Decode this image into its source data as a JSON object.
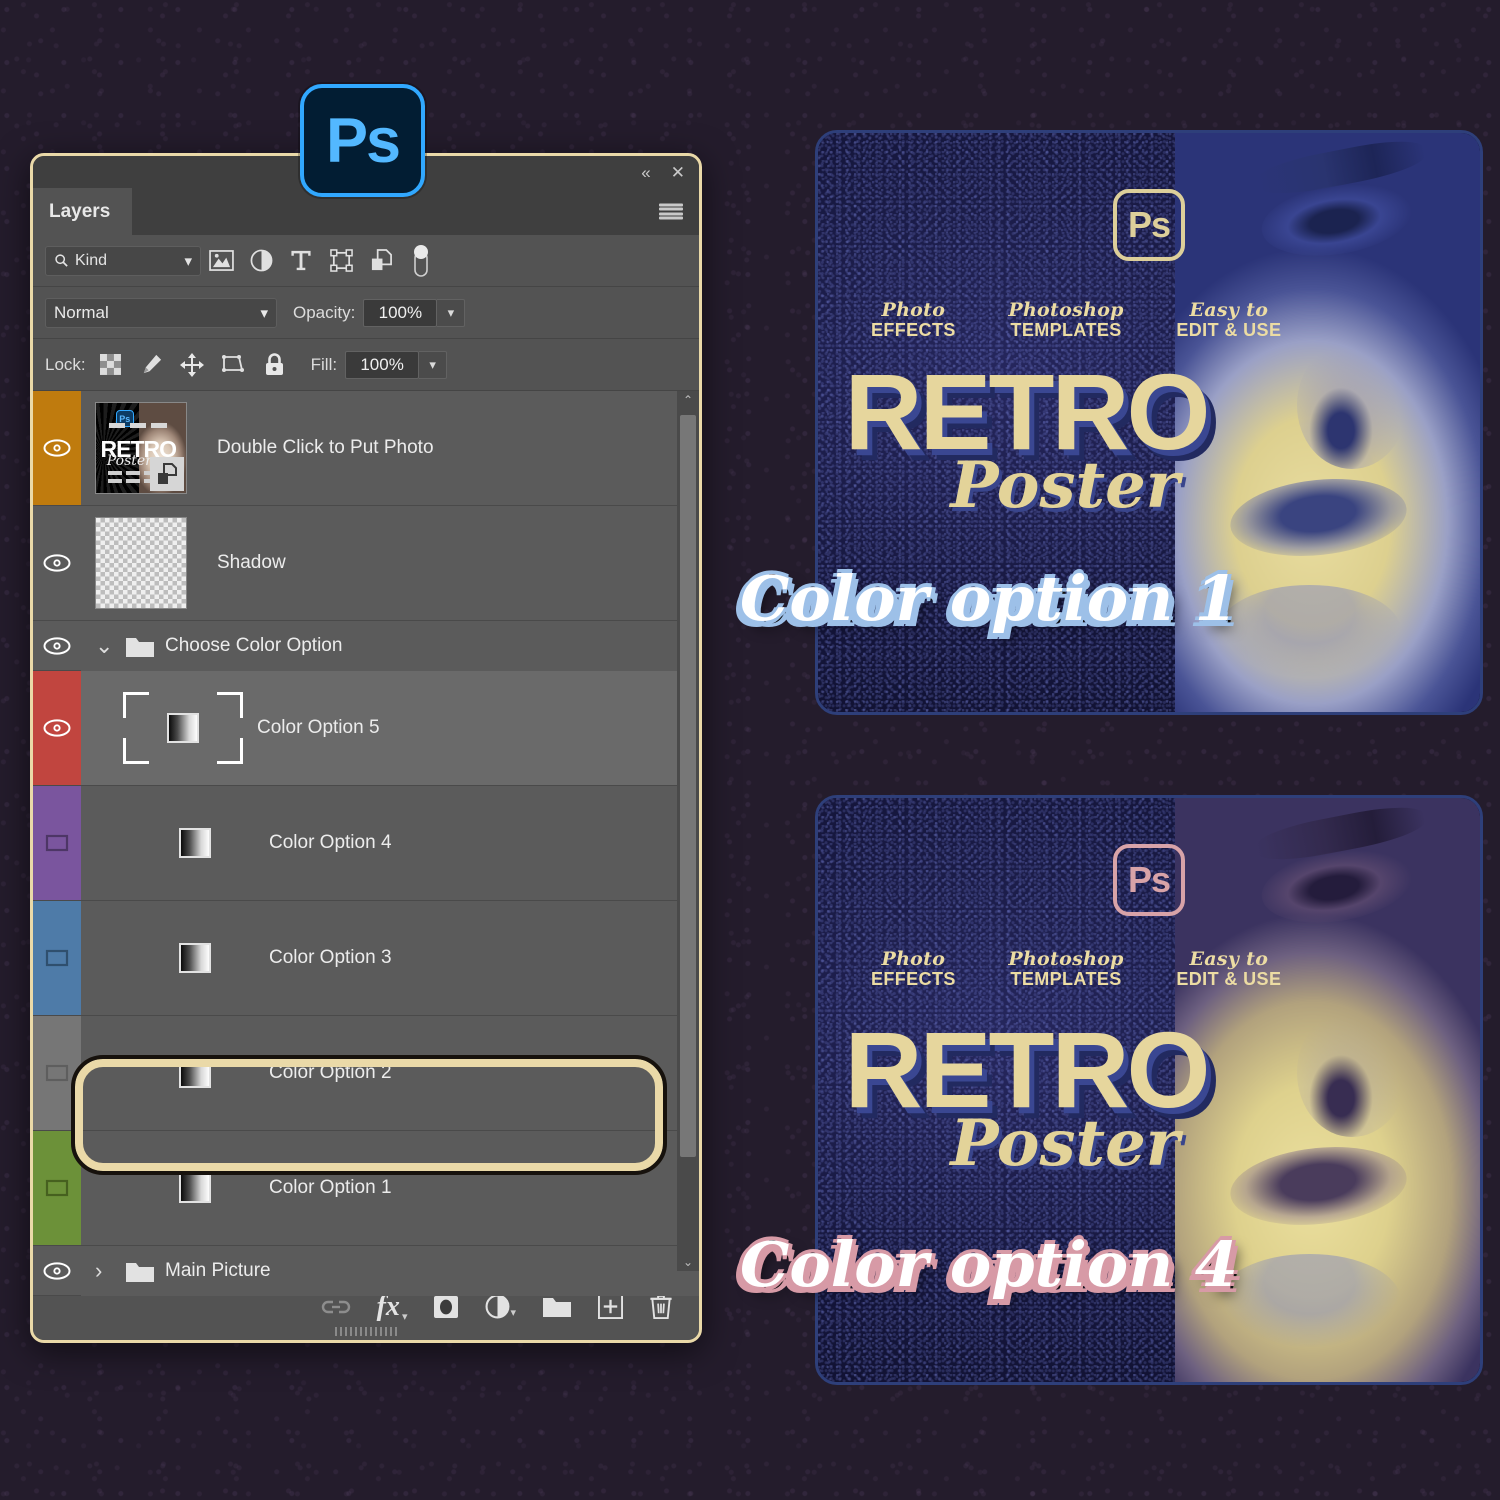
{
  "app": {
    "logo_label": "Ps",
    "background_color": "#241c2c"
  },
  "panel": {
    "tab_label": "Layers",
    "collapse_icon": "«",
    "close_icon": "✕",
    "menu_icon": "hamburger-menu-icon",
    "border_color": "#ead9a8",
    "filter": {
      "kind_label": "Kind",
      "search_icon": "search-icon",
      "chevron": "⌄",
      "icons": [
        "pixel-layer-filter-icon",
        "adjustment-layer-filter-icon",
        "type-layer-filter-icon",
        "shape-layer-filter-icon",
        "smart-object-filter-icon",
        "filter-toggle-switch"
      ]
    },
    "blend": {
      "mode": "Normal",
      "chevron": "⌄",
      "opacity_label": "Opacity:",
      "opacity_value": "100%"
    },
    "lock": {
      "label": "Lock:",
      "fill_label": "Fill:",
      "fill_value": "100%",
      "icons": [
        "lock-transparent-pixels-icon",
        "lock-image-pixels-icon",
        "lock-position-icon",
        "lock-artboard-nesting-icon",
        "lock-all-icon"
      ]
    },
    "layers": [
      {
        "name": "Double Click to Put Photo",
        "visible": true,
        "color_label": "#bf7b0e",
        "kind": "smart-object",
        "thumb": "retro-poster-thumbnail"
      },
      {
        "name": "Shadow",
        "visible": true,
        "color_label": "#5b5b5b",
        "kind": "transparent",
        "thumb": "transparent-checkerboard"
      },
      {
        "name": "Choose Color Option",
        "visible": true,
        "color_label": "#5b5b5b",
        "kind": "group",
        "expanded": true,
        "twirl": "⌄"
      },
      {
        "name": "Color Option 5",
        "visible": true,
        "color_label": "#c1453f",
        "kind": "gradient",
        "selected": true
      },
      {
        "name": "Color Option 4",
        "visible": false,
        "color_label": "#7a559e",
        "kind": "gradient",
        "selected": false
      },
      {
        "name": "Color Option 3",
        "visible": false,
        "color_label": "#4e7ba8",
        "kind": "gradient",
        "selected": false
      },
      {
        "name": "Color Option 2",
        "visible": false,
        "color_label": "#767676",
        "kind": "gradient",
        "selected": false
      },
      {
        "name": "Color Option 1",
        "visible": false,
        "color_label": "#6c9139",
        "kind": "gradient",
        "selected": false
      },
      {
        "name": "Main Picture",
        "visible": true,
        "color_label": "#5b5b5b",
        "kind": "group",
        "expanded": false,
        "twirl": "›"
      }
    ],
    "scrollbar": {
      "up_arrow": "⌃",
      "down_arrow": "⌄"
    },
    "bottom_icons": [
      "link-layers-icon",
      "layer-style-fx-icon",
      "add-layer-mask-icon",
      "new-fill-adjustment-layer-icon",
      "new-group-icon",
      "new-layer-icon",
      "delete-layer-icon"
    ],
    "fx_label": "fx"
  },
  "posters": [
    {
      "id": "poster-top",
      "badge_label": "Ps",
      "badge_color": "#ddcf9a",
      "features": [
        {
          "script": "Photo",
          "caps": "EFFECTS"
        },
        {
          "script": "Photoshop",
          "caps": "TEMPLATES"
        },
        {
          "script": "Easy to",
          "caps": "EDIT & USE"
        }
      ],
      "headline": "RETRO",
      "subhead": "Poster",
      "option_label": "Color option 1",
      "option_outline_color": "#9dc0e8"
    },
    {
      "id": "poster-bottom",
      "badge_label": "Ps",
      "badge_color": "#d8a3a8",
      "features": [
        {
          "script": "Photo",
          "caps": "EFFECTS"
        },
        {
          "script": "Photoshop",
          "caps": "TEMPLATES"
        },
        {
          "script": "Easy to",
          "caps": "EDIT & USE"
        }
      ],
      "headline": "RETRO",
      "subhead": "Poster",
      "option_label": "Color option 4",
      "option_outline_color": "#d79aa6"
    }
  ]
}
